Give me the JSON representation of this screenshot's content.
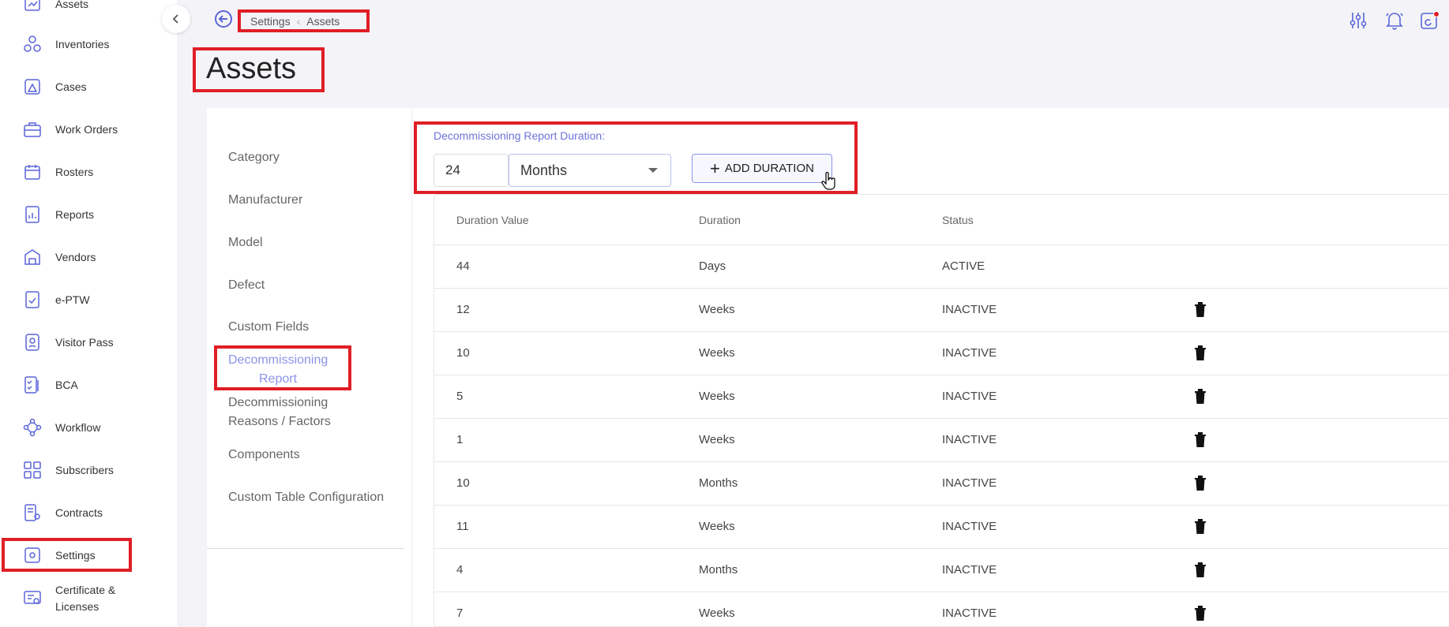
{
  "sidebar": {
    "items": [
      {
        "label": "Assets",
        "icon": "assets-icon"
      },
      {
        "label": "Inventories",
        "icon": "inventories-icon"
      },
      {
        "label": "Cases",
        "icon": "cases-icon"
      },
      {
        "label": "Work Orders",
        "icon": "work-orders-icon"
      },
      {
        "label": "Rosters",
        "icon": "rosters-icon"
      },
      {
        "label": "Reports",
        "icon": "reports-icon"
      },
      {
        "label": "Vendors",
        "icon": "vendors-icon"
      },
      {
        "label": "e-PTW",
        "icon": "eptw-icon"
      },
      {
        "label": "Visitor Pass",
        "icon": "visitor-pass-icon"
      },
      {
        "label": "BCA",
        "icon": "bca-icon"
      },
      {
        "label": "Workflow",
        "icon": "workflow-icon"
      },
      {
        "label": "Subscribers",
        "icon": "subscribers-icon"
      },
      {
        "label": "Contracts",
        "icon": "contracts-icon"
      },
      {
        "label": "Settings",
        "icon": "settings-icon"
      },
      {
        "label": "Certificate &\nLicenses",
        "icon": "certificate-icon"
      }
    ]
  },
  "breadcrumb": {
    "parent": "Settings",
    "current": "Assets"
  },
  "page_title": "Assets",
  "settings_menu": {
    "items": [
      {
        "label": "Category"
      },
      {
        "label": "Manufacturer"
      },
      {
        "label": "Model"
      },
      {
        "label": "Defect"
      },
      {
        "label": "Custom Fields"
      },
      {
        "label": "Decommissioning\nReport",
        "active": true
      },
      {
        "label": "Decommissioning\nReasons / Factors"
      },
      {
        "label": "Components"
      },
      {
        "label": "Custom Table Configuration"
      }
    ]
  },
  "duration_form": {
    "label": "Decommissioning Report Duration:",
    "value": "24",
    "unit": "Months",
    "add_button": "ADD DURATION"
  },
  "table": {
    "headers": [
      "Duration Value",
      "Duration",
      "Status"
    ],
    "rows": [
      {
        "value": "44",
        "duration": "Days",
        "status": "ACTIVE",
        "deletable": false
      },
      {
        "value": "12",
        "duration": "Weeks",
        "status": "INACTIVE",
        "deletable": true
      },
      {
        "value": "10",
        "duration": "Weeks",
        "status": "INACTIVE",
        "deletable": true
      },
      {
        "value": "5",
        "duration": "Weeks",
        "status": "INACTIVE",
        "deletable": true
      },
      {
        "value": "1",
        "duration": "Weeks",
        "status": "INACTIVE",
        "deletable": true
      },
      {
        "value": "10",
        "duration": "Months",
        "status": "INACTIVE",
        "deletable": true
      },
      {
        "value": "11",
        "duration": "Weeks",
        "status": "INACTIVE",
        "deletable": true
      },
      {
        "value": "4",
        "duration": "Months",
        "status": "INACTIVE",
        "deletable": true
      },
      {
        "value": "7",
        "duration": "Weeks",
        "status": "INACTIVE",
        "deletable": true
      }
    ]
  },
  "colors": {
    "accent": "#5a64d8",
    "highlight": "#e01e26",
    "active_menu": "#8b94e8"
  }
}
